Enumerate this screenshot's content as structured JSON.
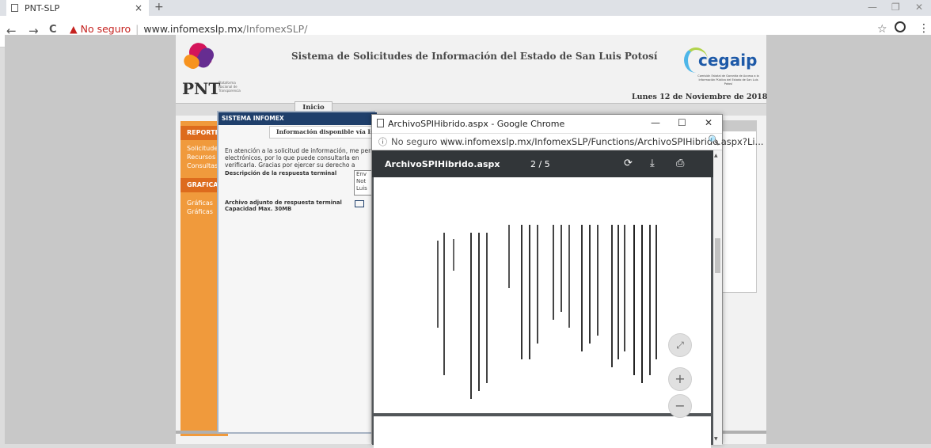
{
  "browser": {
    "tab_title": "PNT-SLP",
    "tab_close": "×",
    "new_tab": "+",
    "security_label": "No seguro",
    "url_domain": "www.infomexslp.mx",
    "url_path": "/InfomexSLP/",
    "back": "←",
    "forward": "→",
    "reload": "C",
    "warn_icon": "▲",
    "star": "☆",
    "menu": "⋮",
    "win_min": "—",
    "win_max": "❐",
    "win_close": "✕"
  },
  "page": {
    "site_title": "Sistema de Solicitudes de Información del Estado de San Luis Potosí",
    "pnt_logo_text": "PNT",
    "pnt_logo_sub": "Plataforma Nacional de Transparencia",
    "cegaip_logo": "cegaip",
    "cegaip_tagline": "Comisión Estatal de Garantía de Acceso a la Información Pública del Estado de San Luis Potosí",
    "date": "Lunes 12 de Noviembre de 2018",
    "nav_tab": "Inicio",
    "sidebar": {
      "section1": "REPORTES",
      "items1": [
        "Solicitudes",
        "Recursos",
        "Consultas"
      ],
      "section2": "GRAFICAS",
      "items2": [
        "Gráficas",
        "Gráficas"
      ]
    }
  },
  "modal": {
    "title": "SISTEMA INFOMEX",
    "tab": "Información disponible vía Infomex",
    "text_lines": [
      "En atención a la solicitud de información, me permito",
      "electrónicos, por lo que puede consultarla en",
      "verificarla. Gracias por ejercer su derecho a"
    ],
    "label_response": "Descripción de la respuesta terminal",
    "response_lines": [
      "Env",
      "Not",
      "Luis"
    ],
    "label_attachment_1": "Archivo adjunto de respuesta terminal",
    "label_attachment_2": "Capacidad Max. 30MB"
  },
  "popup": {
    "window_title": "ArchivoSPIHibrido.aspx - Google Chrome",
    "security_label": "No seguro",
    "info_icon": "ⓘ",
    "url": "www.infomexslp.mx/InfomexSLP/Functions/ArchivoSPIHibrido.aspx?Li...",
    "zoom_icon": "🔍",
    "pdf_name": "ArchivoSPIHibrido.aspx",
    "page_indicator": "2 / 5",
    "rotate_icon": "⟳",
    "download_icon": "⤓",
    "print_icon": "⎙",
    "fit_icon": "⤢",
    "zoom_in": "+",
    "zoom_out": "−",
    "win_min": "—",
    "win_max": "☐",
    "win_close": "✕",
    "scroll_up": "▲",
    "scroll_down": "▼"
  }
}
